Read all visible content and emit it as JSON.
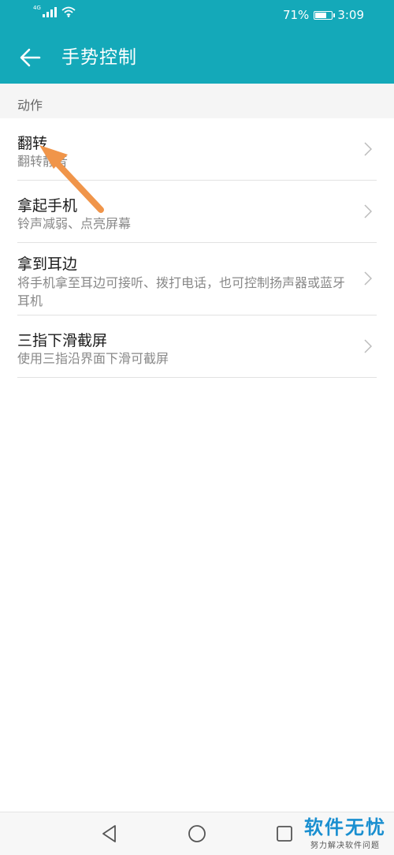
{
  "status_bar": {
    "network": "4G",
    "battery": "71%",
    "battery_level": 0.71,
    "time": "3:09"
  },
  "app_bar": {
    "title": "手势控制"
  },
  "section": {
    "header": "动作"
  },
  "items": [
    {
      "title": "翻转",
      "subtitle": "翻转静音"
    },
    {
      "title": "拿起手机",
      "subtitle": "铃声减弱、点亮屏幕"
    },
    {
      "title": "拿到耳边",
      "subtitle": "将手机拿至耳边可接听、拨打电话，也可控制扬声器或蓝牙耳机"
    },
    {
      "title": "三指下滑截屏",
      "subtitle": "使用三指沿界面下滑可截屏"
    }
  ],
  "watermark": {
    "title": "软件无忧",
    "subtitle": "努力解决软件问题"
  },
  "colors": {
    "accent": "#14a9b9",
    "annotation_arrow": "#f0954a",
    "watermark": "#1a8fd0"
  }
}
